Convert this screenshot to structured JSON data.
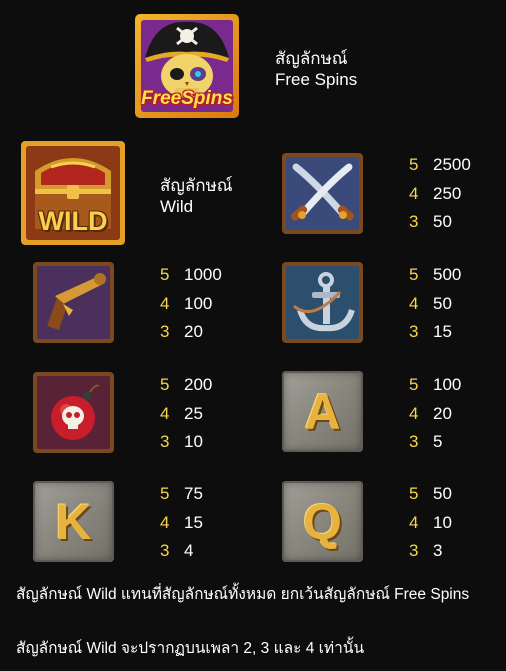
{
  "free_spins": {
    "icon_text": "FreeSpins",
    "label_line1": "สัญลักษณ์",
    "label_line2": "Free Spins"
  },
  "wild": {
    "icon_text": "WILD",
    "label_line1": "สัญลักษณ์",
    "label_line2": "Wild"
  },
  "symbols": [
    {
      "icon": "crossed-swords-icon",
      "pays": [
        {
          "count": "5",
          "value": "2500"
        },
        {
          "count": "4",
          "value": "250"
        },
        {
          "count": "3",
          "value": "50"
        }
      ]
    },
    {
      "icon": "flintlock-pistol-icon",
      "pays": [
        {
          "count": "5",
          "value": "1000"
        },
        {
          "count": "4",
          "value": "100"
        },
        {
          "count": "3",
          "value": "20"
        }
      ]
    },
    {
      "icon": "anchor-icon",
      "pays": [
        {
          "count": "5",
          "value": "500"
        },
        {
          "count": "4",
          "value": "50"
        },
        {
          "count": "3",
          "value": "15"
        }
      ]
    },
    {
      "icon": "skull-bomb-icon",
      "pays": [
        {
          "count": "5",
          "value": "200"
        },
        {
          "count": "4",
          "value": "25"
        },
        {
          "count": "3",
          "value": "10"
        }
      ]
    },
    {
      "icon": "letter-a-icon",
      "letter": "A",
      "pays": [
        {
          "count": "5",
          "value": "100"
        },
        {
          "count": "4",
          "value": "20"
        },
        {
          "count": "3",
          "value": "5"
        }
      ]
    },
    {
      "icon": "letter-k-icon",
      "letter": "K",
      "pays": [
        {
          "count": "5",
          "value": "75"
        },
        {
          "count": "4",
          "value": "15"
        },
        {
          "count": "3",
          "value": "4"
        }
      ]
    },
    {
      "icon": "letter-q-icon",
      "letter": "Q",
      "pays": [
        {
          "count": "5",
          "value": "50"
        },
        {
          "count": "4",
          "value": "10"
        },
        {
          "count": "3",
          "value": "3"
        }
      ]
    }
  ],
  "notes": {
    "wild_substitute": "สัญลักษณ์ Wild แทนที่สัญลักษณ์ทั้งหมด ยกเว้นสัญลักษณ์ Free Spins",
    "wild_reels": "สัญลักษณ์ Wild จะปรากฏบนเพลา 2, 3 และ 4 เท่านั้น"
  },
  "colors": {
    "background": "#0d0d0d",
    "count_yellow": "#f6d648",
    "value_white": "#ffffff"
  }
}
